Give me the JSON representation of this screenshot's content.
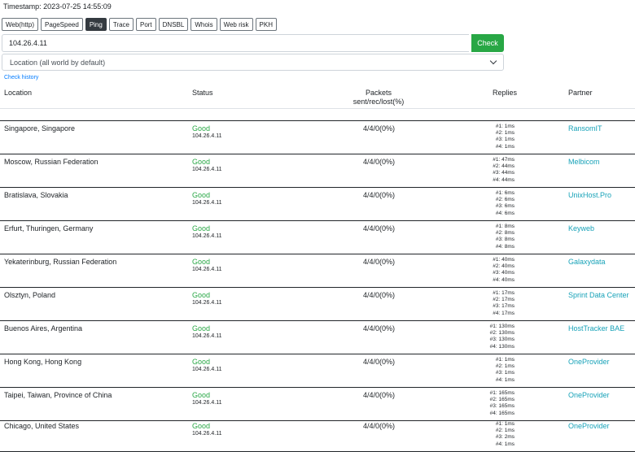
{
  "timestamp": "Timestamp: 2023-07-25 14:55:09",
  "tabs": [
    {
      "label": "Web(http)",
      "active": false
    },
    {
      "label": "PageSpeed",
      "active": false
    },
    {
      "label": "Ping",
      "active": true
    },
    {
      "label": "Trace",
      "active": false
    },
    {
      "label": "Port",
      "active": false
    },
    {
      "label": "DNSBL",
      "active": false
    },
    {
      "label": "Whois",
      "active": false
    },
    {
      "label": "Web risk",
      "active": false
    },
    {
      "label": "PKH",
      "active": false
    }
  ],
  "host_input": {
    "value": "104.26.4.11"
  },
  "check_button": "Check",
  "location_select": "Location (all world by default)",
  "check_history": "Check history",
  "headers": {
    "location": "Location",
    "status": "Status",
    "packets_line1": "Packets",
    "packets_line2": "sent/rec/lost(%)",
    "replies": "Replies",
    "partner": "Partner"
  },
  "colors": {
    "accent_green": "#28a745",
    "partner_link": "#17a2b8",
    "active_tab": "#343a40"
  },
  "rows": [
    {
      "location": "Singapore, Singapore",
      "status": "Good",
      "ip": "104.26.4.11",
      "packets": "4/4/0(0%)",
      "replies": [
        "#1: 1ms",
        "#2: 1ms",
        "#3: 1ms",
        "#4: 1ms"
      ],
      "partner": "RansomIT"
    },
    {
      "location": "Moscow, Russian Federation",
      "status": "Good",
      "ip": "104.26.4.11",
      "packets": "4/4/0(0%)",
      "replies": [
        "#1: 47ms",
        "#2: 44ms",
        "#3: 44ms",
        "#4: 44ms"
      ],
      "partner": "Melbicom"
    },
    {
      "location": "Bratislava, Slovakia",
      "status": "Good",
      "ip": "104.26.4.11",
      "packets": "4/4/0(0%)",
      "replies": [
        "#1: 6ms",
        "#2: 6ms",
        "#3: 6ms",
        "#4: 6ms"
      ],
      "partner": "UnixHost.Pro"
    },
    {
      "location": "Erfurt, Thuringen, Germany",
      "status": "Good",
      "ip": "104.26.4.11",
      "packets": "4/4/0(0%)",
      "replies": [
        "#1: 8ms",
        "#2: 8ms",
        "#3: 8ms",
        "#4: 8ms"
      ],
      "partner": "Keyweb"
    },
    {
      "location": "Yekaterinburg, Russian Federation",
      "status": "Good",
      "ip": "104.26.4.11",
      "packets": "4/4/0(0%)",
      "replies": [
        "#1: 40ms",
        "#2: 40ms",
        "#3: 40ms",
        "#4: 40ms"
      ],
      "partner": "Galaxydata"
    },
    {
      "location": "Olsztyn, Poland",
      "status": "Good",
      "ip": "104.26.4.11",
      "packets": "4/4/0(0%)",
      "replies": [
        "#1: 17ms",
        "#2: 17ms",
        "#3: 17ms",
        "#4: 17ms"
      ],
      "partner": "Sprint Data Center"
    },
    {
      "location": "Buenos Aires, Argentina",
      "status": "Good",
      "ip": "104.26.4.11",
      "packets": "4/4/0(0%)",
      "replies": [
        "#1: 130ms",
        "#2: 130ms",
        "#3: 130ms",
        "#4: 130ms"
      ],
      "partner": "HostTracker BAE"
    },
    {
      "location": "Hong Kong, Hong Kong",
      "status": "Good",
      "ip": "104.26.4.11",
      "packets": "4/4/0(0%)",
      "replies": [
        "#1: 1ms",
        "#2: 1ms",
        "#3: 1ms",
        "#4: 1ms"
      ],
      "partner": "OneProvider"
    },
    {
      "location": "Taipei, Taiwan, Province of China",
      "status": "Good",
      "ip": "104.26.4.11",
      "packets": "4/4/0(0%)",
      "replies": [
        "#1: 165ms",
        "#2: 165ms",
        "#3: 165ms",
        "#4: 165ms"
      ],
      "partner": "OneProvider"
    },
    {
      "location": "Chicago, United States",
      "status": "Good",
      "ip": "104.26.4.11",
      "packets": "4/4/0(0%)",
      "replies": [
        "#1: 1ms",
        "#2: 1ms",
        "#3: 2ms",
        "#4: 1ms"
      ],
      "partner": "OneProvider"
    }
  ]
}
